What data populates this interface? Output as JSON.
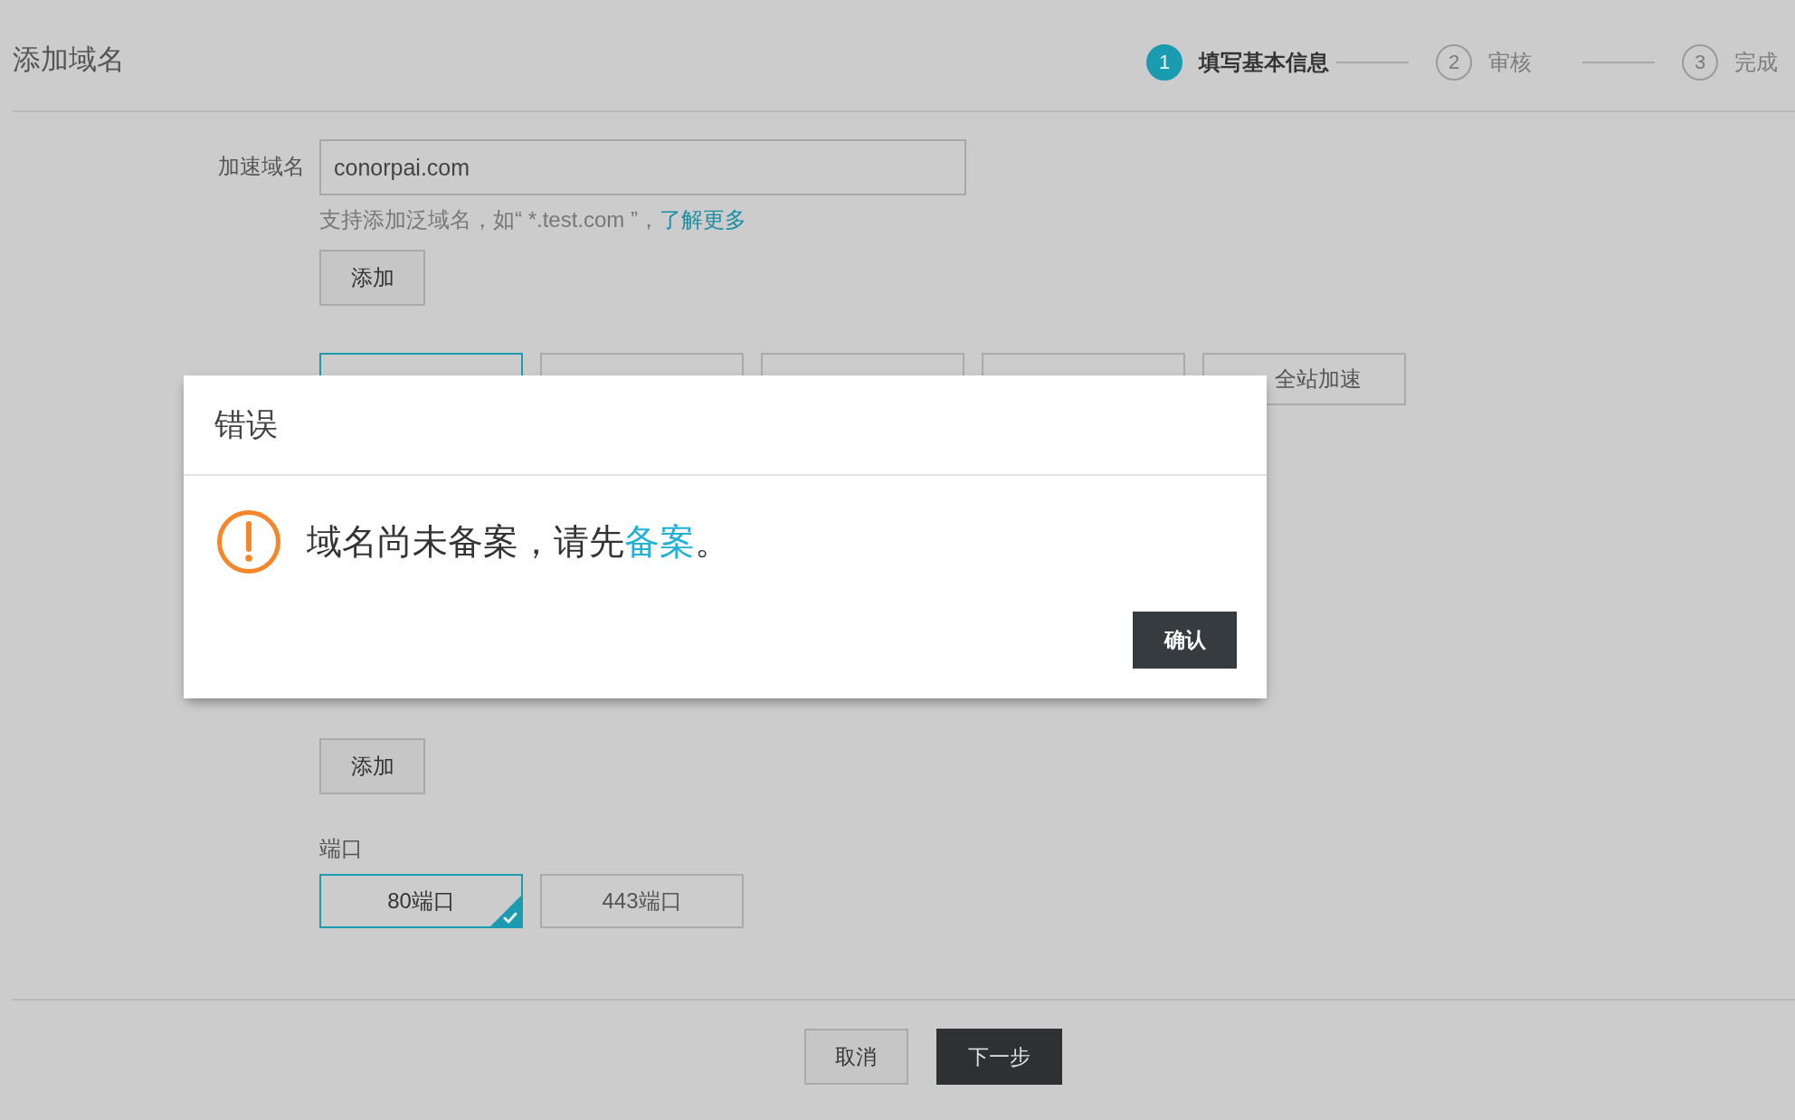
{
  "page": {
    "title": "添加域名"
  },
  "steps": [
    {
      "number": "1",
      "label": "填写基本信息",
      "selected": true
    },
    {
      "number": "2",
      "label": "审核",
      "selected": false
    },
    {
      "number": "3",
      "label": "完成",
      "selected": false
    }
  ],
  "domain": {
    "label": "加速域名",
    "value": "conorpai.com",
    "hint": "支持添加泛域名，如“ *.test.com ”，",
    "hint_link": "了解更多",
    "add_button": "添加"
  },
  "options_row": {
    "options": [
      {
        "selected": true
      },
      {
        "selected": false
      },
      {
        "selected": false
      },
      {
        "selected": false
      },
      {
        "label": "全站加速",
        "selected": false
      }
    ]
  },
  "section_2": {
    "add_button": "添加"
  },
  "port": {
    "label": "端口",
    "options": [
      {
        "label": "80端口",
        "selected": true
      },
      {
        "label": "443端口",
        "selected": false
      }
    ]
  },
  "footer": {
    "buttons": [
      {
        "label": "取消",
        "kind": "secondary"
      },
      {
        "label": "下一步",
        "kind": "primary"
      }
    ]
  },
  "dialog": {
    "title": "错误",
    "message": "域名尚未备案，请先",
    "link": "备案",
    "message_end": "。",
    "confirm_button": "确认"
  }
}
